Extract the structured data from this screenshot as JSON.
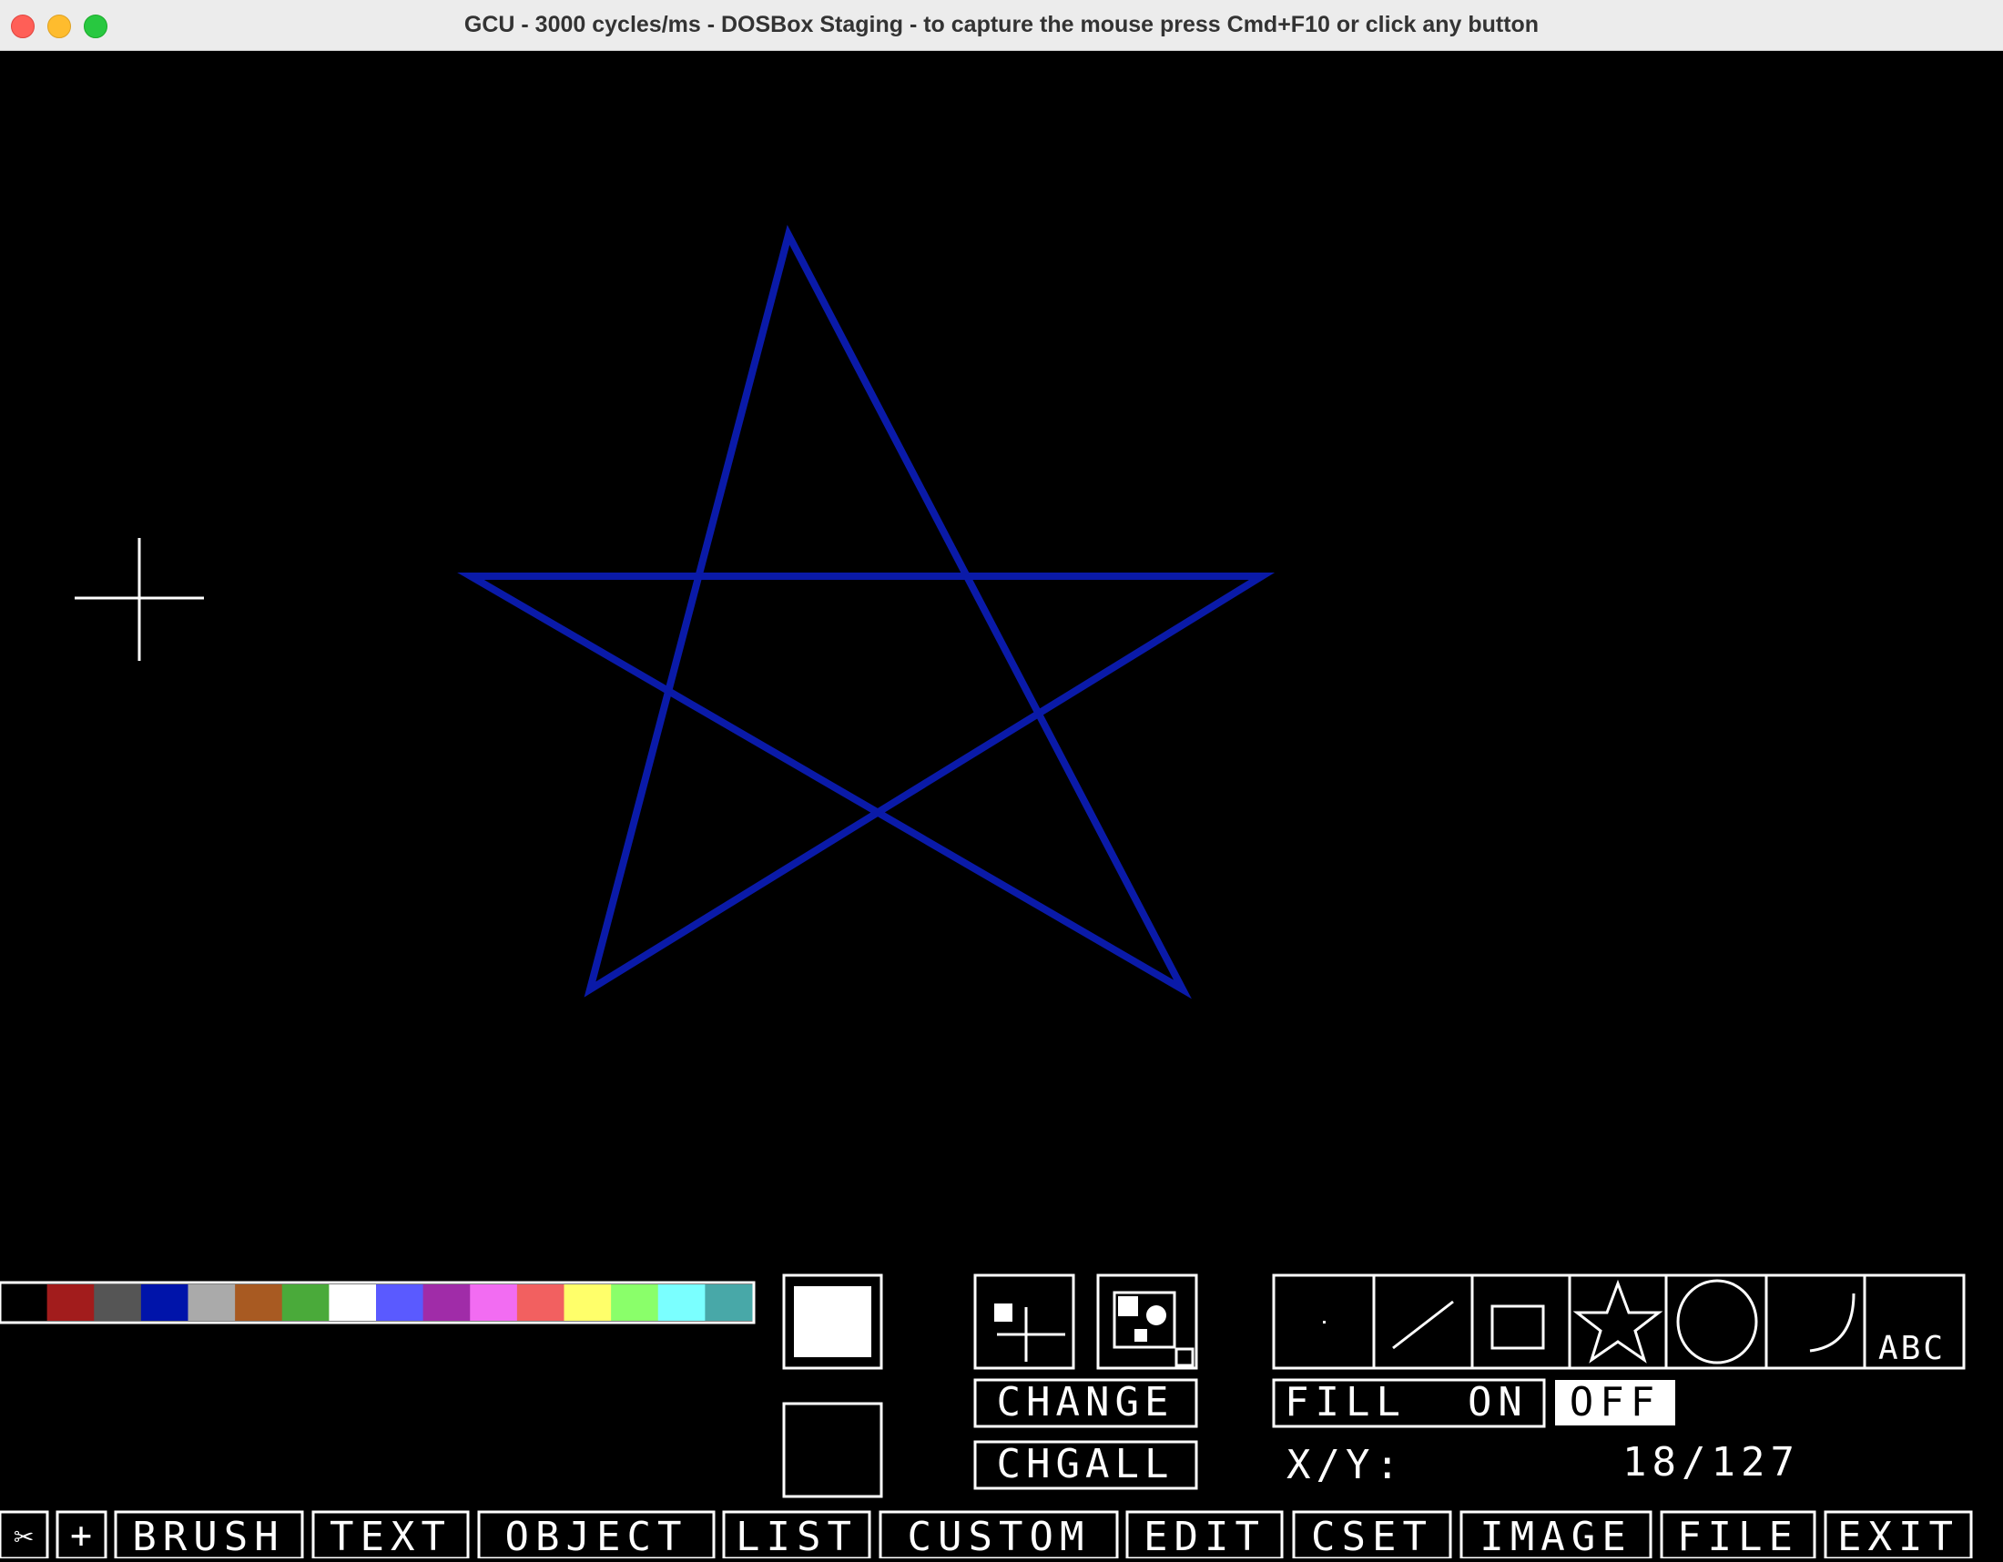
{
  "window": {
    "title": "GCU - 3000 cycles/ms - DOSBox Staging - to capture the mouse press Cmd+F10 or click any button"
  },
  "canvas": {
    "drawing": "star",
    "stroke_color": "#0a1aa8"
  },
  "palette": [
    "#000000",
    "#a21c1c",
    "#555555",
    "#0014aa",
    "#aaaaaa",
    "#a85a22",
    "#4aaa3a",
    "#ffffff",
    "#5a5aff",
    "#a02ca8",
    "#f26cf2",
    "#f26060",
    "#ffff6a",
    "#8aff6a",
    "#7affff",
    "#48a8a8"
  ],
  "colors": {
    "foreground": "#ffffff",
    "background": "#000000"
  },
  "buttons": {
    "change": "CHANGE",
    "chgall": "CHGALL",
    "fill": "FILL  ON",
    "off": "OFF"
  },
  "tools": [
    "point-icon",
    "line-icon",
    "rectangle-icon",
    "star-icon",
    "circle-icon",
    "arc-icon",
    "text-icon"
  ],
  "tool_labels": {
    "text": "ABC"
  },
  "coords": {
    "label": "X/Y:",
    "value": "18/127"
  },
  "menu": {
    "scissors": "✂",
    "plus": "+",
    "brush": "BRUSH",
    "text": "TEXT",
    "object": "OBJECT",
    "list": "LIST",
    "custom": "CUSTOM",
    "edit": "EDIT",
    "cset": "CSET",
    "image": "IMAGE",
    "file": "FILE",
    "exit": "EXIT"
  }
}
